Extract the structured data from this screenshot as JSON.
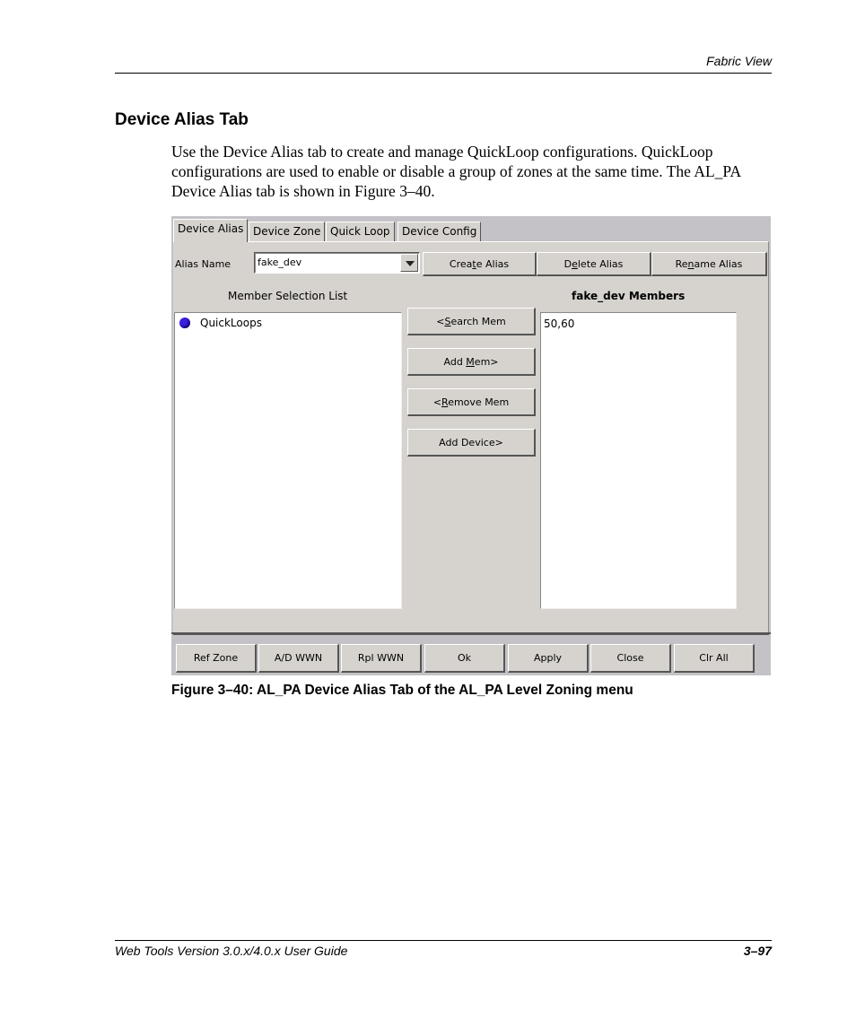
{
  "page": {
    "running_head": "Fabric View",
    "section_title": "Device Alias Tab",
    "body_text": "Use the Device Alias tab to create and manage QuickLoop configurations. QuickLoop configurations are used to enable or disable a group of zones at the same time. The AL_PA Device Alias tab is shown in Figure 3–40.",
    "figure_caption": "Figure 3–40:  AL_PA Device Alias Tab of the AL_PA Level Zoning menu",
    "footer_left": "Web Tools Version 3.0.x/4.0.x User Guide",
    "footer_right": "3–97"
  },
  "ui": {
    "tabs": [
      {
        "label": "Device Alias",
        "active": true
      },
      {
        "label": "Device Zone",
        "active": false
      },
      {
        "label": "Quick Loop",
        "active": false
      },
      {
        "label": "Device Config",
        "active": false
      }
    ],
    "alias_name_label": "Alias Name",
    "alias_name_value": "fake_dev",
    "alias_buttons": {
      "create": {
        "pre": "Crea",
        "u": "t",
        "post": "e Alias"
      },
      "delete": {
        "pre": "D",
        "u": "e",
        "post": "lete Alias"
      },
      "rename": {
        "pre": "Re",
        "u": "n",
        "post": "ame Alias"
      }
    },
    "member_selection_label": "Member Selection List",
    "member_selection_items": [
      {
        "label": "QuickLoops",
        "icon": "blue-circle-icon"
      }
    ],
    "members_label": "fake_dev Members",
    "members_items": [
      "50,60"
    ],
    "middle_buttons": {
      "search": {
        "pre": "<",
        "u": "S",
        "post": "earch Mem"
      },
      "add": {
        "pre": "Add ",
        "u": "M",
        "post": "em>"
      },
      "remove": {
        "pre": "<",
        "u": "R",
        "post": "emove Mem"
      },
      "add_device": {
        "pre": "Add Device>",
        "u": "",
        "post": ""
      }
    },
    "footer_buttons": [
      "Ref Zone",
      "A/D WWN",
      "Rpl WWN",
      "Ok",
      "Apply",
      "Close",
      "Clr All"
    ],
    "colors": {
      "panel": "#d6d3ce",
      "tab_strip": "#c4c2c6",
      "quickloop_icon": "#3a1fe0"
    }
  }
}
